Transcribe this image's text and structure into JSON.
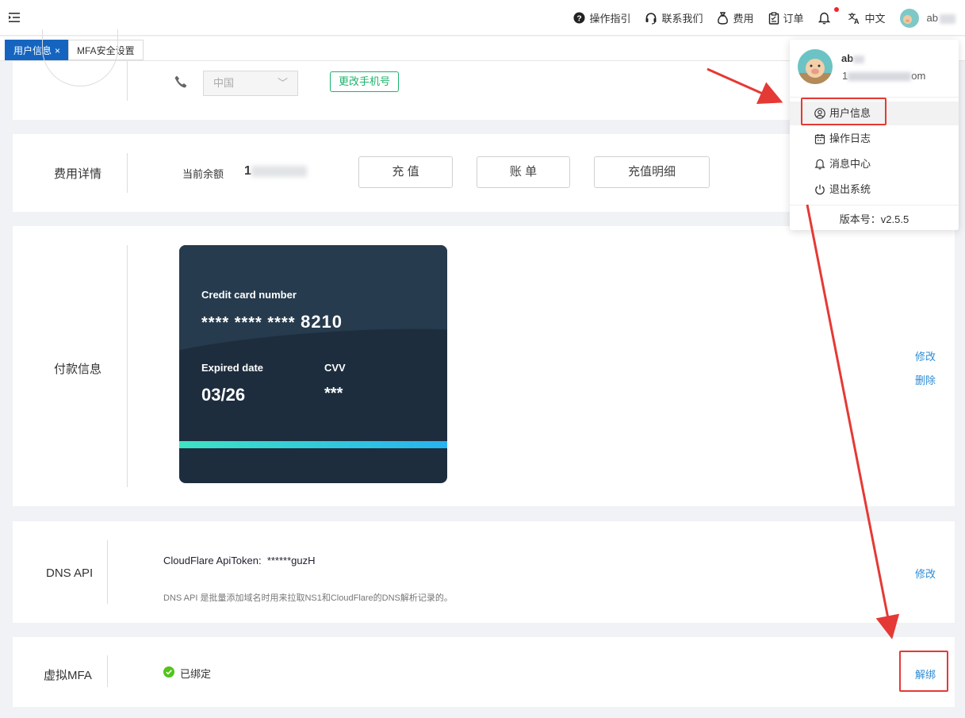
{
  "topbar": {
    "guide": "操作指引",
    "contact": "联系我们",
    "fees": "费用",
    "orders": "订单",
    "language": "中文",
    "username": "ab"
  },
  "tabs": [
    {
      "label": "用户信息",
      "close": "×",
      "active": true
    },
    {
      "label": "MFA安全设置",
      "active": false
    }
  ],
  "phone": {
    "country_select": "中国",
    "change_phone_button": "更改手机号"
  },
  "fee": {
    "section_label": "费用详情",
    "balance_label": "当前余额",
    "balance_value_partial": "1",
    "recharge_button": "充 值",
    "bill_button": "账 单",
    "recharge_detail_button": "充值明细"
  },
  "payment": {
    "section_label": "付款信息",
    "card_number_label": "Credit card number",
    "card_number_masked": "**** **** ****",
    "card_number_last4": "8210",
    "expired_label": "Expired date",
    "expired_value": "03/26",
    "cvv_label": "CVV",
    "cvv_value": "***",
    "edit_link": "修改",
    "delete_link": "删除"
  },
  "dns": {
    "section_label": "DNS API",
    "token_label": "CloudFlare ApiToken:",
    "token_value": "******guzH",
    "description": "DNS API 是批量添加域名时用来拉取NS1和CloudFlare的DNS解析记录的。",
    "edit_link": "修改"
  },
  "mfa": {
    "section_label": "虚拟MFA",
    "status": "已绑定",
    "unbind_link": "解绑"
  },
  "dropdown": {
    "name": "ab",
    "email_prefix": "1",
    "email_suffix": "om",
    "items": [
      {
        "label": "用户信息",
        "icon": "user-circle-icon"
      },
      {
        "label": "操作日志",
        "icon": "calendar-icon"
      },
      {
        "label": "消息中心",
        "icon": "bell-icon"
      },
      {
        "label": "退出系统",
        "icon": "power-icon"
      }
    ],
    "version": "版本号：v2.5.5"
  },
  "colors": {
    "primary": "#1565c0",
    "link": "#2d8cd6",
    "success": "#1bb36a",
    "annotation_red": "#e53935"
  }
}
